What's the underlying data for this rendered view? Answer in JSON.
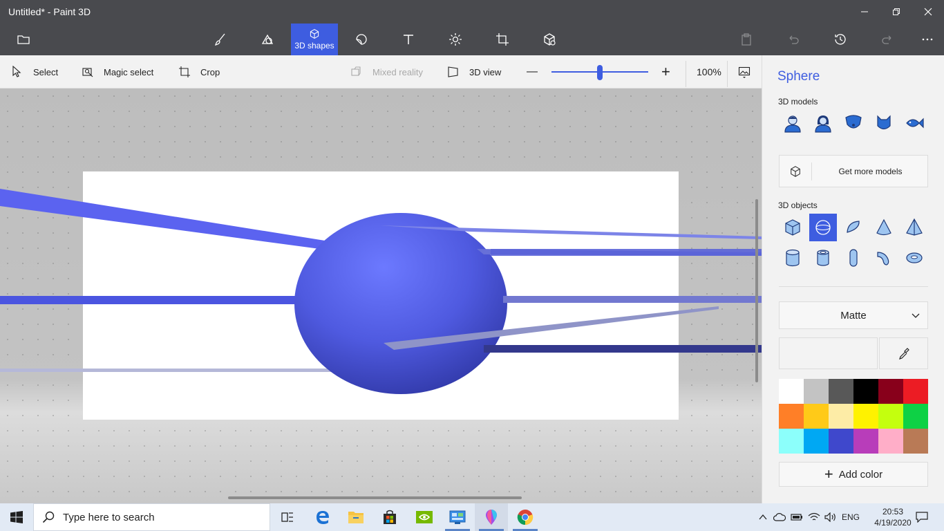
{
  "window": {
    "title": "Untitled* - Paint 3D",
    "minimize_icon": "minimize-icon",
    "restore_icon": "restore-icon",
    "close_icon": "close-icon"
  },
  "main_toolbar": {
    "menu_icon": "folder-icon",
    "tools": [
      {
        "name": "brushes",
        "icon": "brush-icon",
        "label": ""
      },
      {
        "name": "2d-shapes",
        "icon": "2d-shapes-icon",
        "label": ""
      },
      {
        "name": "3d-shapes",
        "icon": "cube-icon",
        "label": "3D shapes",
        "active": true
      },
      {
        "name": "stickers",
        "icon": "sticker-icon",
        "label": ""
      },
      {
        "name": "text",
        "icon": "text-icon",
        "label": ""
      },
      {
        "name": "effects",
        "icon": "sun-icon",
        "label": ""
      },
      {
        "name": "canvas",
        "icon": "canvas-icon",
        "label": ""
      },
      {
        "name": "3d-library",
        "icon": "3d-library-icon",
        "label": ""
      }
    ],
    "right_actions": [
      "paste-icon",
      "undo-icon",
      "history-icon",
      "redo-icon",
      "more-icon"
    ]
  },
  "sub_toolbar": {
    "select": "Select",
    "magic_select": "Magic select",
    "crop": "Crop",
    "mixed_reality": "Mixed reality",
    "view_3d": "3D view",
    "zoom_minus": "—",
    "zoom_plus": "+",
    "zoom_percent": "100%",
    "zoom_value": 0.5
  },
  "panel": {
    "title": "Sphere",
    "models_label": "3D models",
    "models": [
      "man-icon",
      "woman-icon",
      "dog-icon",
      "cat-icon",
      "fish-icon"
    ],
    "get_more": "Get more models",
    "objects_label": "3D objects",
    "objects": [
      "cube-icon",
      "sphere-icon",
      "hemisphere-icon",
      "cone-icon",
      "pyramid-icon",
      "cylinder-icon",
      "tube-icon",
      "capsule-icon",
      "curved-tube-icon",
      "torus-icon"
    ],
    "selected_object": "sphere-icon",
    "material": "Matte",
    "add_color": "Add color",
    "palette": [
      "#ffffff",
      "#c3c3c3",
      "#585858",
      "#000000",
      "#88001b",
      "#ec1c24",
      "#ff7f27",
      "#ffca18",
      "#fdeca6",
      "#fff200",
      "#c4ff0e",
      "#0ed145",
      "#8cfffb",
      "#00a8f3",
      "#3f48cc",
      "#b83dba",
      "#ffaec8",
      "#b97a56"
    ]
  },
  "taskbar": {
    "search_placeholder": "Type here to search",
    "apps": [
      "task-view-icon",
      "edge-icon",
      "file-explorer-icon",
      "store-icon",
      "nvidia-icon",
      "control-panel-icon",
      "paint3d-icon",
      "chrome-icon"
    ],
    "language": "ENG",
    "time": "20:53",
    "date": "4/19/2020"
  },
  "colors": {
    "accent": "#3e5de0",
    "sphere": "#5a66e8"
  }
}
